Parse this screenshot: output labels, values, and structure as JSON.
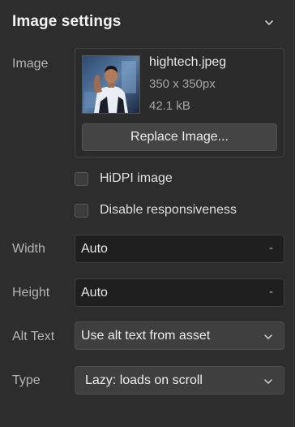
{
  "header": {
    "title": "Image settings",
    "chevron_icon": "chevron-down-icon"
  },
  "image": {
    "label": "Image",
    "file_name": "hightech.jpeg",
    "dimensions": "350 x 350px",
    "file_size": "42.1 kB",
    "replace_label": "Replace Image...",
    "thumbnail_icon": "person-photo-thumbnail"
  },
  "options": {
    "hidpi_label": "HiDPI image",
    "hidpi_checked": false,
    "disable_responsive_label": "Disable responsiveness",
    "disable_responsive_checked": false
  },
  "width": {
    "label": "Width",
    "value": "Auto",
    "unit": "-"
  },
  "height": {
    "label": "Height",
    "value": "Auto",
    "unit": "-"
  },
  "alt_text": {
    "label": "Alt Text",
    "selected": "Use alt text from asset"
  },
  "type": {
    "label": "Type",
    "selected": "Lazy: loads on scroll"
  },
  "colors": {
    "panel_bg": "#2d2d2d",
    "field_bg": "#1f1f1f",
    "select_bg": "#3f3f3f",
    "button_bg": "#444444",
    "text_primary": "#e8e8e8",
    "text_label": "#b5b5b5"
  }
}
